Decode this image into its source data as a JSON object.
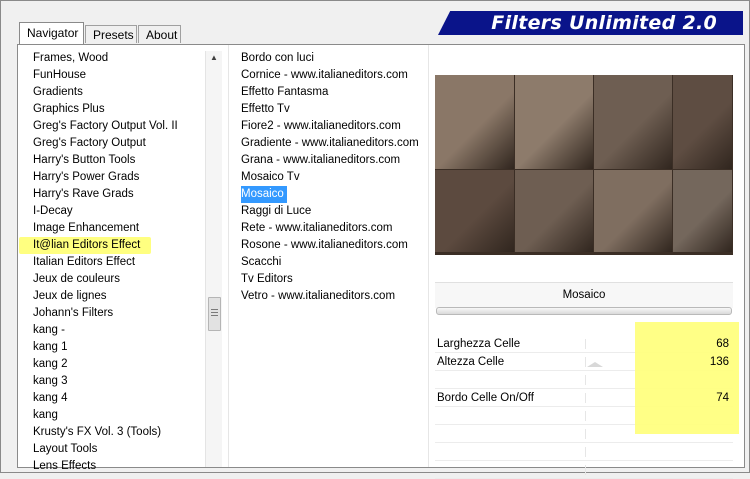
{
  "tabs": [
    {
      "label": "Navigator",
      "active": true
    },
    {
      "label": "Presets",
      "active": false
    },
    {
      "label": "About",
      "active": false
    }
  ],
  "banner": {
    "title": "Filters Unlimited 2.0",
    "color": "#0a148a"
  },
  "categories": {
    "items": [
      "Frames, Wood",
      "FunHouse",
      "Gradients",
      "Graphics Plus",
      "Greg's Factory Output Vol. II",
      "Greg's Factory Output",
      "Harry's Button Tools",
      "Harry's Power Grads",
      "Harry's Rave Grads",
      "I-Decay",
      "Image Enhancement",
      "It@lian Editors Effect",
      "Italian Editors Effect",
      "Jeux de couleurs",
      "Jeux de lignes",
      "Johann's Filters",
      "kang -",
      "kang 1",
      "kang 2",
      "kang 3",
      "kang 4",
      "kang",
      "Krusty's FX Vol. 3 (Tools)",
      "Layout Tools",
      "Lens Effects"
    ],
    "highlighted": "It@lian Editors Effect"
  },
  "filters": {
    "items": [
      "Bordo con luci",
      "Cornice - www.italianeditors.com",
      "Effetto Fantasma",
      "Effetto Tv",
      "Fiore2 - www.italianeditors.com",
      "Gradiente - www.italianeditors.com",
      "Grana - www.italianeditors.com",
      "Mosaico Tv",
      "Mosaico",
      "Raggi di Luce",
      "Rete - www.italianeditors.com",
      "Rosone - www.italianeditors.com",
      "Scacchi",
      "Tv Editors",
      "Vetro - www.italianeditors.com"
    ],
    "selected": "Mosaico"
  },
  "filter_name": "Mosaico",
  "params": [
    {
      "label": "Larghezza Celle",
      "value": "68"
    },
    {
      "label": "Altezza Celle",
      "value": "136"
    },
    {
      "label": "",
      "value": ""
    },
    {
      "label": "Bordo Celle On/Off",
      "value": "74"
    },
    {
      "label": "",
      "value": ""
    },
    {
      "label": "",
      "value": ""
    },
    {
      "label": "",
      "value": ""
    },
    {
      "label": "",
      "value": ""
    }
  ],
  "colors": {
    "highlight": "#ffff80",
    "selection": "#3399ff",
    "preview_border": "#3b2e25"
  },
  "preview_tiles": [
    "#8a7767",
    "#8d7b6b",
    "#6e5e52",
    "#5e4d42",
    "#5c4a3f",
    "#6e5e52",
    "#7f6e60",
    "#74675c"
  ]
}
